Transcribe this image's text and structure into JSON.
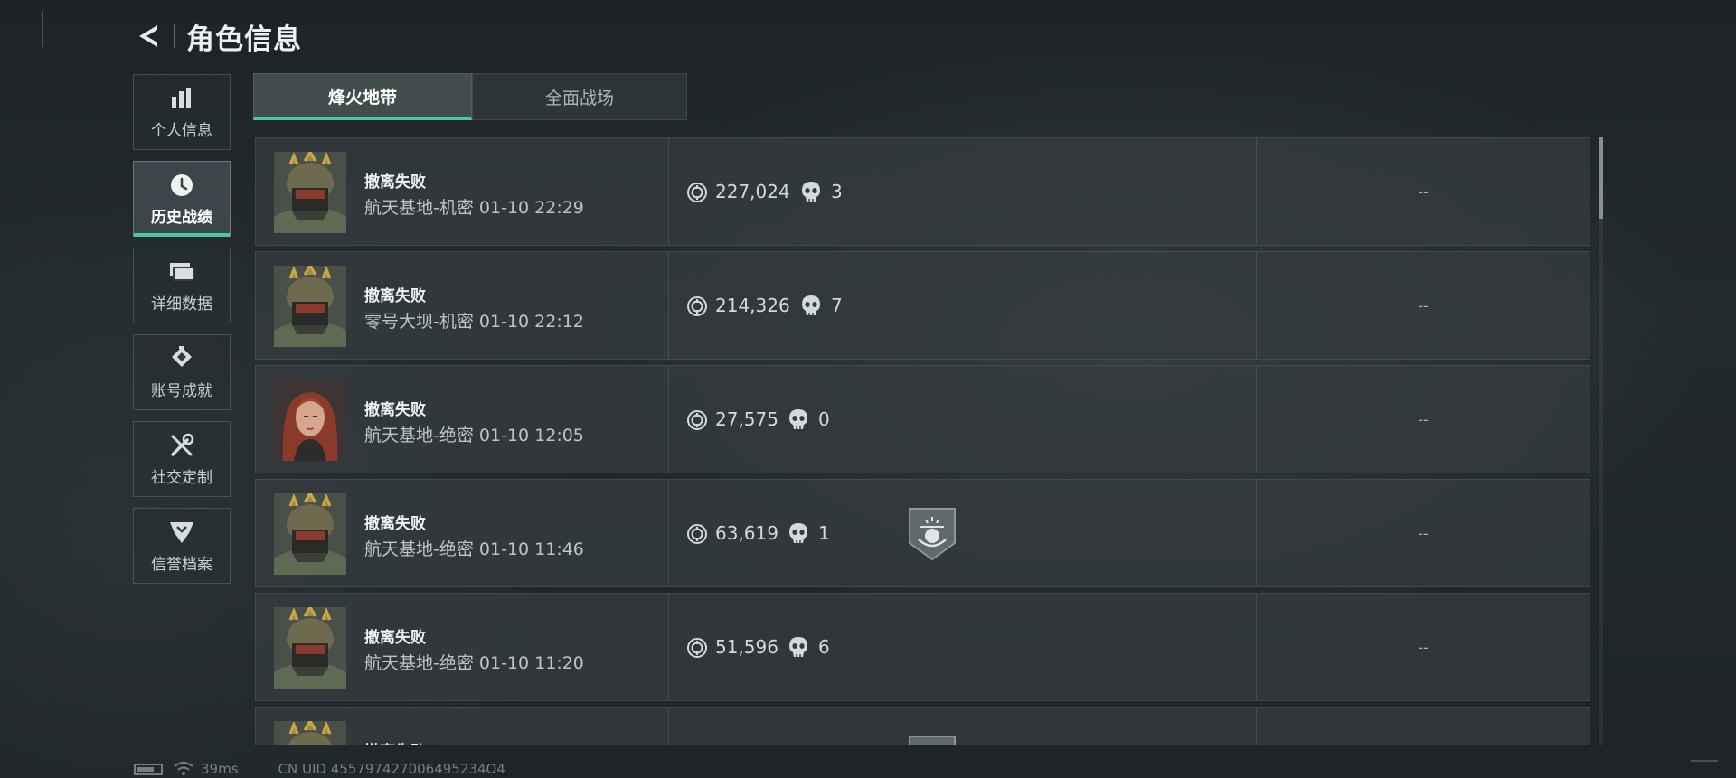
{
  "header": {
    "title": "角色信息",
    "back_icon": "back-arrow-icon"
  },
  "sidebar": {
    "items": [
      {
        "label": "个人信息",
        "icon": "bar-chart-icon",
        "active": false
      },
      {
        "label": "历史战绩",
        "icon": "clock-icon",
        "active": true
      },
      {
        "label": "详细数据",
        "icon": "cards-icon",
        "active": false
      },
      {
        "label": "账号成就",
        "icon": "achievement-icon",
        "active": false
      },
      {
        "label": "社交定制",
        "icon": "tools-icon",
        "active": false
      },
      {
        "label": "信誉档案",
        "icon": "reputation-icon",
        "active": false
      }
    ]
  },
  "tabs": [
    {
      "label": "烽火地带",
      "active": true
    },
    {
      "label": "全面战场",
      "active": false
    }
  ],
  "records": [
    {
      "avatar": "soldier-avatar",
      "status": "撤离失败",
      "map_time": "航天基地-机密 01-10 22:29",
      "value": "227,024",
      "kills": "3",
      "badge": false,
      "extra": "--"
    },
    {
      "avatar": "soldier-avatar",
      "status": "撤离失败",
      "map_time": "零号大坝-机密 01-10 22:12",
      "value": "214,326",
      "kills": "7",
      "badge": false,
      "extra": "--"
    },
    {
      "avatar": "female-avatar",
      "status": "撤离失败",
      "map_time": "航天基地-绝密 01-10 12:05",
      "value": "27,575",
      "kills": "0",
      "badge": false,
      "extra": "--"
    },
    {
      "avatar": "soldier-avatar",
      "status": "撤离失败",
      "map_time": "航天基地-绝密 01-10 11:46",
      "value": "63,619",
      "kills": "1",
      "badge": true,
      "extra": "--"
    },
    {
      "avatar": "soldier-avatar",
      "status": "撤离失败",
      "map_time": "航天基地-绝密 01-10 11:20",
      "value": "51,596",
      "kills": "6",
      "badge": false,
      "extra": "--"
    },
    {
      "avatar": "soldier-avatar",
      "status": "撤离失败",
      "map_time": "",
      "value": "",
      "kills": "",
      "badge": true,
      "extra": ""
    }
  ],
  "statusbar": {
    "ping": "39ms",
    "uid": "CN UID 455797427006495234O4"
  },
  "colors": {
    "accent": "#4fc7a2",
    "background": "#1f2528",
    "row_bg": "#343b3e"
  }
}
